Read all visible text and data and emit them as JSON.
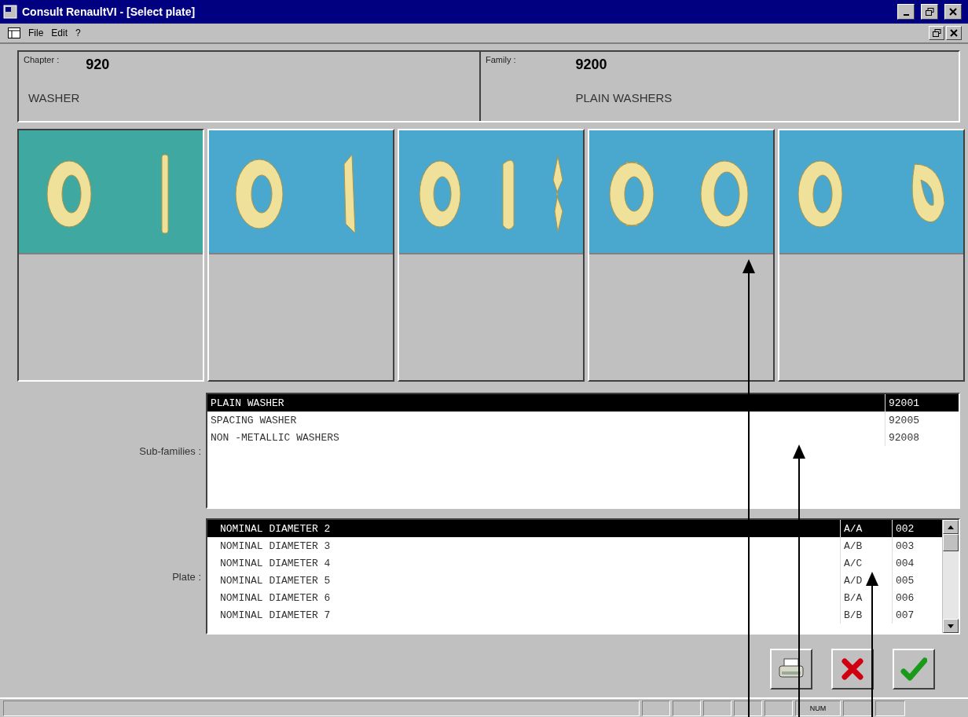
{
  "window": {
    "title": "Consult RenaultVI - [Select plate]"
  },
  "menu": [
    "File",
    "Edit",
    "?"
  ],
  "header": {
    "chapter": {
      "label": "Chapter :",
      "code": "920",
      "name": "WASHER"
    },
    "family": {
      "label": "Family :",
      "code": "9200",
      "name": "PLAIN WASHERS"
    }
  },
  "plates": [
    {
      "selected": true
    },
    {
      "selected": false
    },
    {
      "selected": false
    },
    {
      "selected": false
    },
    {
      "selected": false
    }
  ],
  "sub_families": {
    "label": "Sub-families :",
    "rows": [
      {
        "name": "PLAIN WASHER",
        "code": "92001",
        "selected": true
      },
      {
        "name": "SPACING WASHER",
        "code": "92005",
        "selected": false
      },
      {
        "name": "NON -METALLIC WASHERS",
        "code": "92008",
        "selected": false
      }
    ]
  },
  "plate_list": {
    "label": "Plate :",
    "rows": [
      {
        "name": "NOMINAL DIAMETER 2",
        "code": "A/A",
        "number": "002",
        "selected": true
      },
      {
        "name": "NOMINAL DIAMETER 3",
        "code": "A/B",
        "number": "003",
        "selected": false
      },
      {
        "name": "NOMINAL DIAMETER 4",
        "code": "A/C",
        "number": "004",
        "selected": false
      },
      {
        "name": "NOMINAL DIAMETER 5",
        "code": "A/D",
        "number": "005",
        "selected": false
      },
      {
        "name": "NOMINAL DIAMETER 6",
        "code": "B/A",
        "number": "006",
        "selected": false
      },
      {
        "name": "NOMINAL DIAMETER 7",
        "code": "B/B",
        "number": "007",
        "selected": false
      }
    ]
  },
  "status_bar": {
    "indicator": "NUM"
  }
}
